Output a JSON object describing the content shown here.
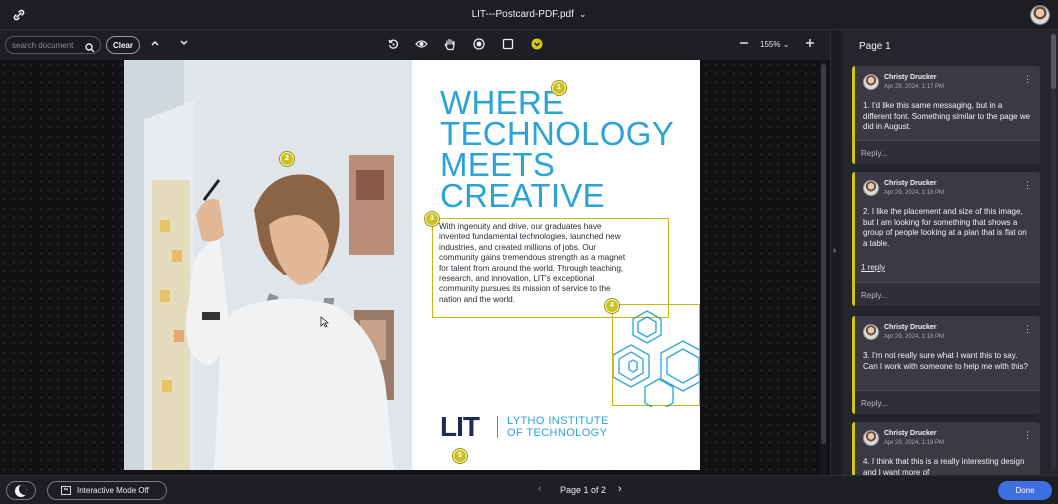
{
  "header": {
    "file_title": "LIT---Postcard-PDF.pdf",
    "logo_icon": "link-icon",
    "avatar_icon": "user-avatar"
  },
  "toolbar": {
    "search_placeholder": "search document",
    "clear_label": "Clear",
    "zoom_label": "155%",
    "icons": [
      "search-icon",
      "chevron-up-icon",
      "chevron-down-icon",
      "rotate-icon",
      "eye-icon",
      "hand-icon",
      "record-icon",
      "square-icon",
      "comment-pin-icon",
      "zoom-out-icon",
      "zoom-in-icon"
    ]
  },
  "document": {
    "headline": [
      "WHERE",
      "TECHNOLOGY",
      "MEETS",
      "CREATIVE"
    ],
    "body_lines": [
      "With ingenuity and drive, our graduates have",
      "invented fundamental technologies, launched new",
      "industries, and created millions of jobs. Our",
      "community gains tremendous strength as a magnet",
      "for talent from around the world. Through teaching,",
      "research, and innovation, LIT's exceptional",
      "community pursues its mission of service to the",
      "nation and the world."
    ],
    "logo_mark": "LIT",
    "logo_name": [
      "LYTHO INSTITUTE",
      "OF TECHNOLOGY"
    ],
    "pins": [
      "1",
      "2",
      "3",
      "4",
      "5"
    ],
    "accent_color": "#2aa3d8",
    "pin_color": "#c9c226"
  },
  "panel": {
    "title": "Page 1",
    "comments": [
      {
        "author": "Christy Drucker",
        "date": "Apr 29, 2024, 1:17 PM",
        "text": "1. I'd like this same messaging, but in a different font. Something similar to the page we did in August.",
        "replies": "",
        "reply_label": "Reply..."
      },
      {
        "author": "Christy Drucker",
        "date": "Apr 29, 2024, 1:18 PM",
        "text": "2. I like the placement and size of this image, but I am looking for something that shows a group of people looking at a plan that is flat on a table.",
        "replies": "1 reply",
        "reply_label": "Reply..."
      },
      {
        "author": "Christy Drucker",
        "date": "Apr 29, 2024, 1:18 PM",
        "text": "3. I'm not really sure what I want this to say. Can I work with someone to help me with this?",
        "replies": "",
        "reply_label": "Reply..."
      },
      {
        "author": "Christy Drucker",
        "date": "Apr 29, 2024, 1:19 PM",
        "text": "4. I think that this is a really interesting design and I want more of",
        "replies": "",
        "reply_label": ""
      }
    ]
  },
  "footer": {
    "mode_label": "Interactive Mode Off",
    "page_label": "Page 1 of 2",
    "done_label": "Done",
    "done_color": "#3d6fe0"
  }
}
